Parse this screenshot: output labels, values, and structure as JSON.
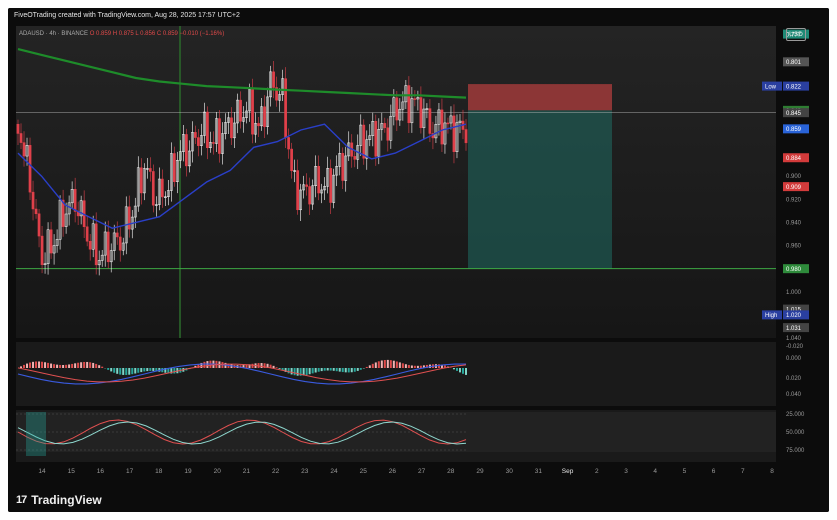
{
  "watermark": "FiveOTrading created with TradingView.com, Aug 28, 2025 17:57 UTC+2",
  "legend": {
    "symbol": "ADAUSD · 4h · BINANCE",
    "ohlc": "O 0.859  H 0.875  L 0.856  C 0.859  −0.010 (−1.16%)"
  },
  "currency_button": "USD",
  "brand": "TradingView",
  "brand_logo": "17",
  "colors": {
    "background": "#121212",
    "candle_up": "#ffffff",
    "candle_down": "#e0404a",
    "ma_slow": "#1e8c2a",
    "ma_fast": "#2a3fc8",
    "support": "#3da843",
    "risk_zone": "#e54848",
    "reward_zone": "#1f6b62"
  },
  "chart_data": [
    {
      "type": "line",
      "name": "price",
      "axis": {
        "inverted": true,
        "ylim": [
          0.77,
          1.04
        ],
        "tick_labels": [
          "0.777",
          "0.801",
          "0.843",
          "0.845",
          "0.859",
          "0.884",
          "0.900",
          "0.920",
          "0.940",
          "0.960",
          "0.980",
          "1.000",
          "1.015",
          "1.020",
          "1.031",
          "1.040"
        ],
        "price_tags": [
          {
            "label": "0.777",
            "color": "#1f8a76"
          },
          {
            "label": "0.801",
            "color": "#555555"
          },
          {
            "label": "0.822",
            "color": "#2a3fa0",
            "tag": "Low"
          },
          {
            "label": "0.843",
            "color": "#2e7d32"
          },
          {
            "label": "0.845",
            "color": "#444444"
          },
          {
            "label": "0.859",
            "color": "#2963d8"
          },
          {
            "label": "0.884",
            "color": "#d33b3b"
          },
          {
            "label": "0.909",
            "color": "#d33b3b"
          },
          {
            "label": "0.980",
            "color": "#2e8b3b"
          },
          {
            "label": "1.015",
            "color": "#444444"
          },
          {
            "label": "1.020",
            "color": "#2a3fa0",
            "tag": "High"
          },
          {
            "label": "1.031",
            "color": "#444444"
          }
        ]
      },
      "x_ticks": [
        "14",
        "15",
        "16",
        "17",
        "18",
        "19",
        "20",
        "21",
        "22",
        "23",
        "24",
        "25",
        "26",
        "27",
        "28",
        "29",
        "30",
        "31",
        "Sep",
        "2",
        "3",
        "4",
        "5",
        "6",
        "7",
        "8"
      ],
      "series": [
        {
          "name": "close",
          "values": [
            0.855,
            0.9,
            0.97,
            0.96,
            0.93,
            0.92,
            0.95,
            0.97,
            0.96,
            0.955,
            0.93,
            0.89,
            0.92,
            0.91,
            0.88,
            0.875,
            0.86,
            0.87,
            0.86,
            0.85,
            0.84,
            0.86,
            0.82,
            0.83,
            0.91,
            0.915,
            0.905,
            0.91,
            0.89,
            0.88,
            0.87,
            0.865,
            0.86,
            0.84,
            0.835,
            0.84,
            0.86,
            0.855,
            0.86,
            0.859
          ]
        },
        {
          "name": "ma_slow",
          "values": [
            0.79,
            0.795,
            0.8,
            0.805,
            0.81,
            0.815,
            0.818,
            0.82,
            0.822,
            0.823,
            0.824,
            0.825,
            0.826,
            0.827,
            0.828,
            0.829,
            0.83,
            0.83,
            0.831,
            0.832
          ]
        },
        {
          "name": "ma_fast",
          "values": [
            0.88,
            0.9,
            0.925,
            0.935,
            0.945,
            0.94,
            0.935,
            0.92,
            0.905,
            0.895,
            0.875,
            0.87,
            0.86,
            0.855,
            0.875,
            0.885,
            0.88,
            0.87,
            0.86,
            0.855
          ]
        }
      ],
      "levels": [
        {
          "name": "support",
          "value": 0.98
        },
        {
          "name": "entry",
          "value": 0.845
        }
      ],
      "position_zones": [
        {
          "name": "stop",
          "from": 0.822,
          "to": 0.843
        },
        {
          "name": "target",
          "from": 0.843,
          "to": 0.98
        }
      ]
    },
    {
      "type": "bar",
      "name": "macd",
      "axis": {
        "tick_labels": [
          "-0.020",
          "0.000",
          "0.020",
          "0.040"
        ]
      }
    },
    {
      "type": "line",
      "name": "stoch",
      "axis": {
        "tick_labels": [
          "25.000",
          "50.000",
          "75.000"
        ]
      }
    }
  ]
}
